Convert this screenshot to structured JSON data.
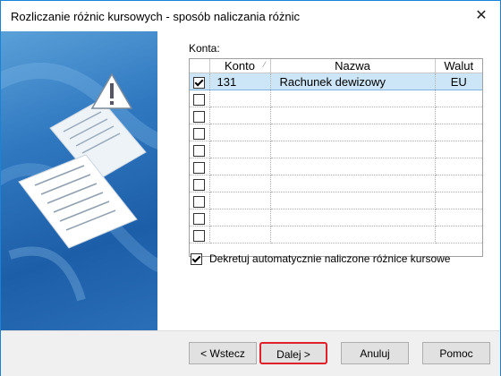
{
  "window": {
    "title": "Rozliczanie różnic kursowych - sposób naliczania różnic",
    "close_glyph": "✕"
  },
  "konta_label": "Konta:",
  "grid": {
    "columns": [
      "Konto",
      "Nazwa",
      "Walut"
    ],
    "rows": [
      {
        "checked": true,
        "konto": "131",
        "nazwa": "Rachunek dewizowy",
        "waluta": "EU"
      },
      {
        "checked": false,
        "konto": "",
        "nazwa": "",
        "waluta": ""
      },
      {
        "checked": false,
        "konto": "",
        "nazwa": "",
        "waluta": ""
      },
      {
        "checked": false,
        "konto": "",
        "nazwa": "",
        "waluta": ""
      },
      {
        "checked": false,
        "konto": "",
        "nazwa": "",
        "waluta": ""
      },
      {
        "checked": false,
        "konto": "",
        "nazwa": "",
        "waluta": ""
      },
      {
        "checked": false,
        "konto": "",
        "nazwa": "",
        "waluta": ""
      },
      {
        "checked": false,
        "konto": "",
        "nazwa": "",
        "waluta": ""
      },
      {
        "checked": false,
        "konto": "",
        "nazwa": "",
        "waluta": ""
      },
      {
        "checked": false,
        "konto": "",
        "nazwa": "",
        "waluta": ""
      }
    ]
  },
  "auto_option": {
    "checked": true,
    "label": "Dekretuj automatycznie naliczone różnice kursowe"
  },
  "buttons": {
    "back": "< Wstecz",
    "next": "Dalej >",
    "cancel": "Anuluj",
    "help": "Pomoc"
  },
  "side_icon": "warning-icon"
}
